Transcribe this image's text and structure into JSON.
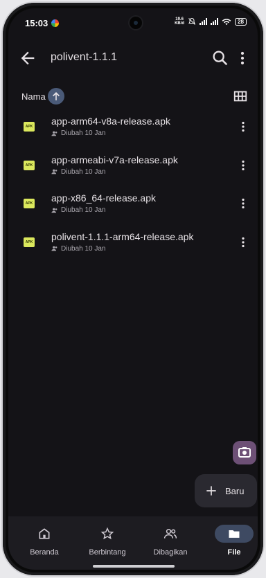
{
  "status_bar": {
    "time": "15:03",
    "net_speed_value": "19.6",
    "net_speed_unit": "KB/d",
    "battery": "28"
  },
  "app_bar": {
    "title": "polivent-1.1.1"
  },
  "sort": {
    "label": "Nama"
  },
  "files": [
    {
      "name": "app-arm64-v8a-release.apk",
      "meta": "Diubah 10 Jan",
      "badge": "APK"
    },
    {
      "name": "app-armeabi-v7a-release.apk",
      "meta": "Diubah 10 Jan",
      "badge": "APK"
    },
    {
      "name": "app-x86_64-release.apk",
      "meta": "Diubah 10 Jan",
      "badge": "APK"
    },
    {
      "name": "polivent-1.1.1-arm64-release.apk",
      "meta": "Diubah 10 Jan",
      "badge": "APK"
    }
  ],
  "fab": {
    "new_label": "Baru"
  },
  "nav": [
    {
      "label": "Beranda",
      "icon": "home-icon"
    },
    {
      "label": "Berbintang",
      "icon": "star-icon"
    },
    {
      "label": "Dibagikan",
      "icon": "people-icon"
    },
    {
      "label": "File",
      "icon": "folder-icon",
      "active": true
    }
  ],
  "colors": {
    "background": "#141317",
    "apk_badge": "#dbe85d",
    "accent": "#4a5a78",
    "fab_camera": "#6d5076"
  }
}
